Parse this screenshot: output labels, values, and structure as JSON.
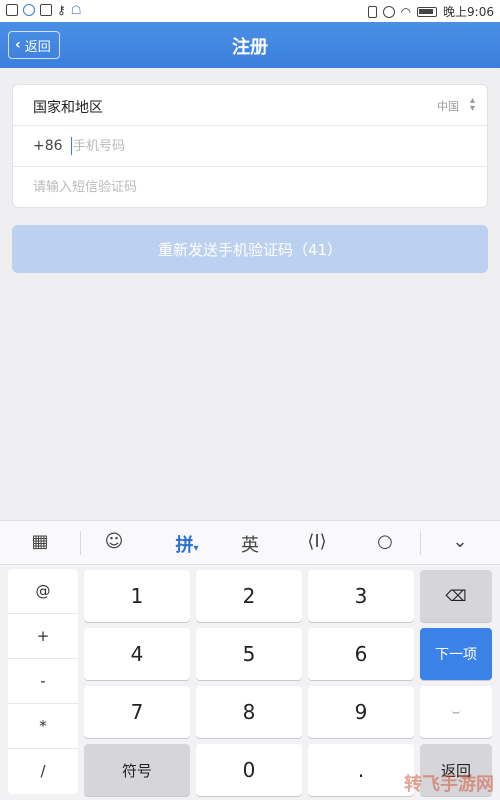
{
  "status_bar": {
    "time": "晚上9:06",
    "left_icons": [
      "message-icon",
      "shield-icon",
      "file-icon",
      "key-icon",
      "android-icon"
    ],
    "right_icons": [
      "vibrate-icon",
      "alarm-icon",
      "wifi-icon",
      "battery-icon"
    ]
  },
  "navbar": {
    "back_label": "返回",
    "title": "注册",
    "color": "#3b7fdc"
  },
  "form": {
    "region_label": "国家和地区",
    "region_value": "中国",
    "phone_prefix": "+86",
    "phone_placeholder": "手机号码",
    "code_placeholder": "请输入短信验证码"
  },
  "resend_button": {
    "label": "重新发送手机验证码（41）"
  },
  "keyboard": {
    "toolbar": [
      "grid-icon",
      "emoji-icon",
      "拼",
      "英",
      "cursor-icon",
      "search-icon",
      "collapse-icon"
    ],
    "pinyin_label": "拼",
    "english_label": "英",
    "symbols": [
      "@",
      "+",
      "-",
      "*",
      "/"
    ],
    "keys": [
      "1",
      "2",
      "3",
      "4",
      "5",
      "6",
      "7",
      "8",
      "9",
      "符号",
      "0",
      "."
    ],
    "next_label": "下一项",
    "back_label": "返回",
    "accent": "#3b82e8"
  },
  "watermark": "转飞手游网"
}
